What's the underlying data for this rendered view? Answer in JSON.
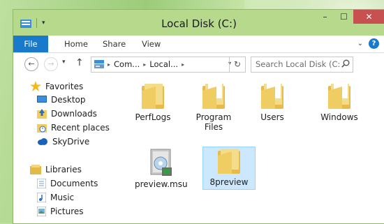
{
  "window": {
    "title": "Local Disk (C:)",
    "caption_buttons": {
      "minimize": "–",
      "maximize": "☐",
      "close": "✕"
    }
  },
  "ribbon": {
    "tabs": [
      "File",
      "Home",
      "Share",
      "View"
    ],
    "expand": "⌄",
    "help": "?"
  },
  "navigation": {
    "back": "←",
    "forward": "→",
    "recent": "▾",
    "up": "↑",
    "address_segments": [
      "Com...",
      "Local..."
    ],
    "address_seps": [
      "▸",
      "▸",
      "▸"
    ],
    "address_dropdown": "▾",
    "refresh": "↻",
    "search_placeholder": "Search Local Disk (C:)"
  },
  "nav_pane": {
    "favorites_label": "Favorites",
    "favorites": [
      "Desktop",
      "Downloads",
      "Recent places",
      "SkyDrive"
    ],
    "libraries_label": "Libraries",
    "libraries": [
      "Documents",
      "Music",
      "Pictures"
    ]
  },
  "files": [
    {
      "name": "PerfLogs",
      "type": "folder"
    },
    {
      "name": "Program Files",
      "type": "folder"
    },
    {
      "name": "Users",
      "type": "folder"
    },
    {
      "name": "Windows",
      "type": "folder"
    },
    {
      "name": "preview.msu",
      "type": "installer"
    },
    {
      "name": "8preview",
      "type": "folder",
      "selected": true
    }
  ],
  "colors": {
    "accent": "#1979ca",
    "close": "#c75050",
    "selection": "#cce8ff",
    "folder": "#f0cd62"
  }
}
